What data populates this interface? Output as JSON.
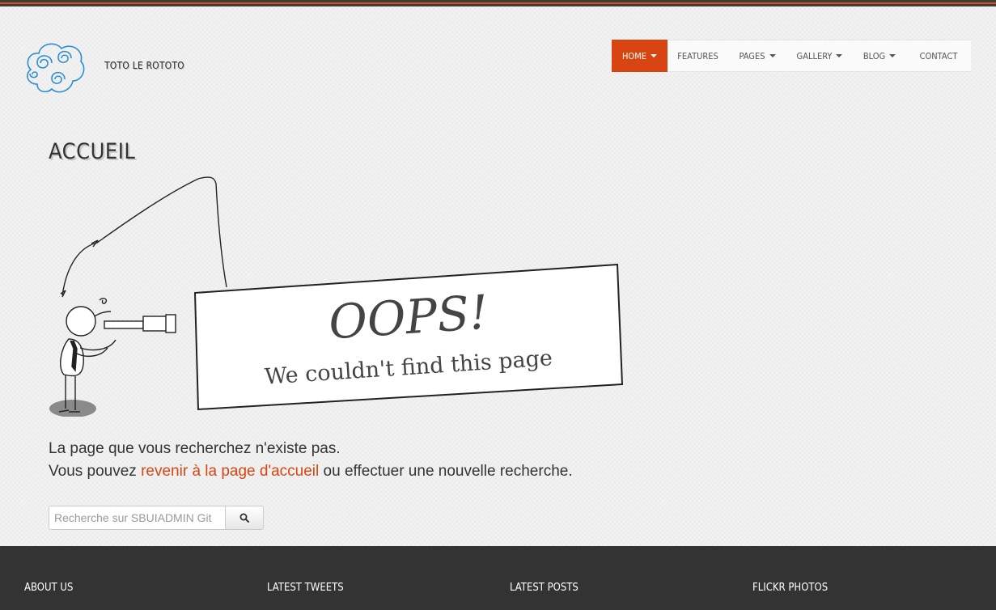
{
  "brand": {
    "name": "TOTO LE ROTOTO",
    "logo_icon": "spiral-cloud-logo-icon"
  },
  "nav": {
    "items": [
      {
        "label": "HOME",
        "dropdown": true,
        "active": true
      },
      {
        "label": "FEATURES",
        "dropdown": false,
        "active": false
      },
      {
        "label": "PAGES",
        "dropdown": true,
        "active": false
      },
      {
        "label": "GALLERY",
        "dropdown": true,
        "active": false
      },
      {
        "label": "BLOG",
        "dropdown": true,
        "active": false
      },
      {
        "label": "CONTACT",
        "dropdown": false,
        "active": false
      }
    ]
  },
  "page": {
    "title": "ACCUEIL"
  },
  "illustration": {
    "heading": "OOPS!",
    "subheading": "We couldn't find this page"
  },
  "message": {
    "line1": "La page que vous recherchez n'existe pas.",
    "line2_before": "Vous pouvez ",
    "line2_link": "revenir à la page d'accueil",
    "line2_after": " ou effectuer une nouvelle recherche."
  },
  "search": {
    "placeholder": "Recherche sur SBUIADMIN Git",
    "value": "",
    "button_icon": "search-icon"
  },
  "footer": {
    "headings": [
      "ABOUT US",
      "LATEST TWEETS",
      "LATEST POSTS",
      "FLICKR PHOTOS"
    ]
  },
  "colors": {
    "accent": "#d94512",
    "footer_bg": "#333333",
    "logo": "#2a8fd0"
  }
}
